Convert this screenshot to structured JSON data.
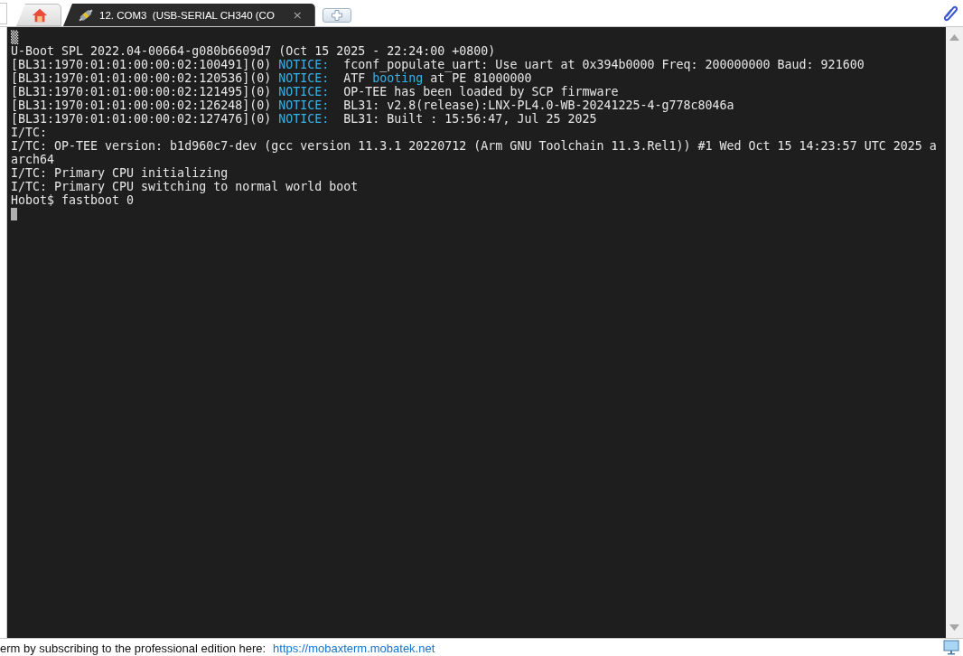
{
  "tabs": [
    {
      "kind": "home",
      "selected": false
    },
    {
      "kind": "session",
      "label": "12. COM3  (USB-SERIAL CH340 (CO",
      "close": "×",
      "selected": true
    }
  ],
  "terminal": {
    "lines": [
      [
        {
          "kind": "normal",
          "text": "▒"
        }
      ],
      [
        {
          "kind": "normal",
          "text": "U-Boot SPL 2022.04-00664-g080b6609d7 (Oct 15 2025 - 22:24:00 +0800)"
        }
      ],
      [
        {
          "kind": "normal",
          "text": "[BL31:1970:01:01:00:00:02:100491](0) "
        },
        {
          "kind": "keyword",
          "text": "NOTICE:"
        },
        {
          "kind": "normal",
          "text": "  fconf_populate_uart: Use uart at 0x394b0000 Freq: 200000000 Baud: 921600"
        }
      ],
      [
        {
          "kind": "normal",
          "text": "[BL31:1970:01:01:00:00:02:120536](0) "
        },
        {
          "kind": "keyword",
          "text": "NOTICE:"
        },
        {
          "kind": "normal",
          "text": "  ATF "
        },
        {
          "kind": "keyword",
          "text": "booting"
        },
        {
          "kind": "normal",
          "text": " at PE 81000000"
        }
      ],
      [
        {
          "kind": "normal",
          "text": "[BL31:1970:01:01:00:00:02:121495](0) "
        },
        {
          "kind": "keyword",
          "text": "NOTICE:"
        },
        {
          "kind": "normal",
          "text": "  OP-TEE has been loaded by SCP firmware"
        }
      ],
      [
        {
          "kind": "normal",
          "text": "[BL31:1970:01:01:00:00:02:126248](0) "
        },
        {
          "kind": "keyword",
          "text": "NOTICE:"
        },
        {
          "kind": "normal",
          "text": "  BL31: v2.8(release):LNX-PL4.0-WB-20241225-4-g778c8046a"
        }
      ],
      [
        {
          "kind": "normal",
          "text": "[BL31:1970:01:01:00:00:02:127476](0) "
        },
        {
          "kind": "keyword",
          "text": "NOTICE:"
        },
        {
          "kind": "normal",
          "text": "  BL31: Built : 15:56:47, Jul 25 2025"
        }
      ],
      [
        {
          "kind": "normal",
          "text": "I/TC:"
        }
      ],
      [
        {
          "kind": "normal",
          "text": "I/TC: OP-TEE version: b1d960c7-dev (gcc version 11.3.1 20220712 (Arm GNU Toolchain 11.3.Rel1)) #1 Wed Oct 15 14:23:57 UTC 2025 a"
        }
      ],
      [
        {
          "kind": "normal",
          "text": "arch64"
        }
      ],
      [
        {
          "kind": "normal",
          "text": "I/TC: Primary CPU initializing"
        }
      ],
      [
        {
          "kind": "normal",
          "text": "I/TC: Primary CPU switching to normal world boot"
        }
      ],
      [
        {
          "kind": "normal",
          "text": "Hobot$ fastboot 0"
        }
      ]
    ]
  },
  "status_bar": {
    "text": "erm by subscribing to the professional edition here:",
    "link": "https://mobaxterm.mobatek.net"
  }
}
